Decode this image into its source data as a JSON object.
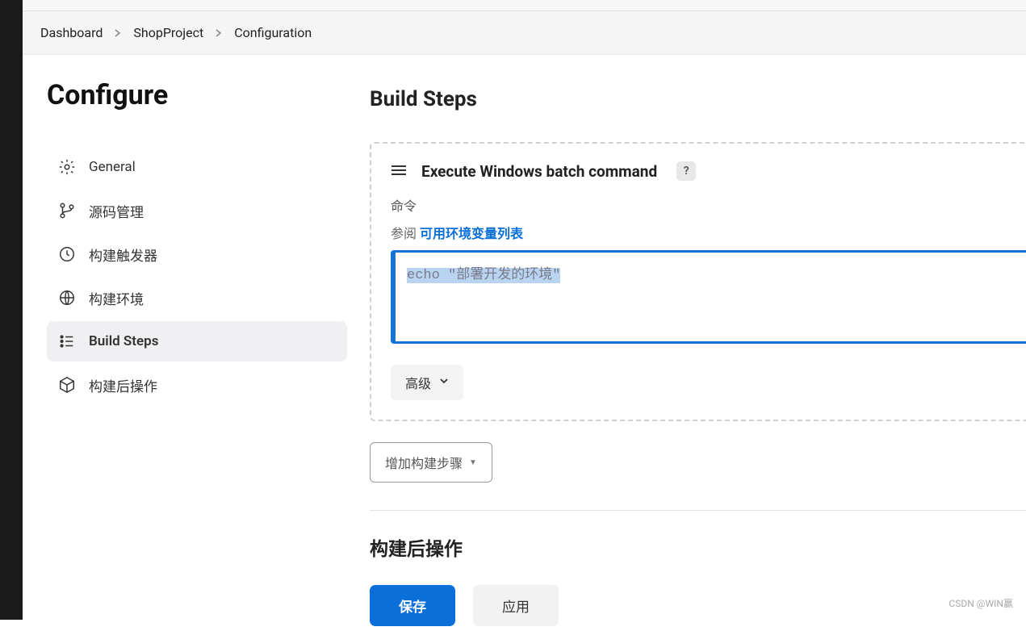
{
  "breadcrumb": {
    "items": [
      "Dashboard",
      "ShopProject",
      "Configuration"
    ]
  },
  "sidebar": {
    "title": "Configure",
    "nav": [
      {
        "label": "General"
      },
      {
        "label": "源码管理"
      },
      {
        "label": "构建触发器"
      },
      {
        "label": "构建环境"
      },
      {
        "label": "Build Steps"
      },
      {
        "label": "构建后操作"
      }
    ],
    "active_index": 4
  },
  "content": {
    "section_title": "Build Steps",
    "step": {
      "title": "Execute Windows batch command",
      "help": "?",
      "field_label": "命令",
      "hint_prefix": "参阅",
      "hint_link": "可用环境变量列表",
      "command_value": "echo \"部署开发的环境\"",
      "advanced_label": "高级"
    },
    "add_step_label": "增加构建步骤",
    "post_actions_title": "构建后操作",
    "save_label": "保存",
    "apply_label": "应用"
  },
  "watermark": "CSDN @WIN赢"
}
